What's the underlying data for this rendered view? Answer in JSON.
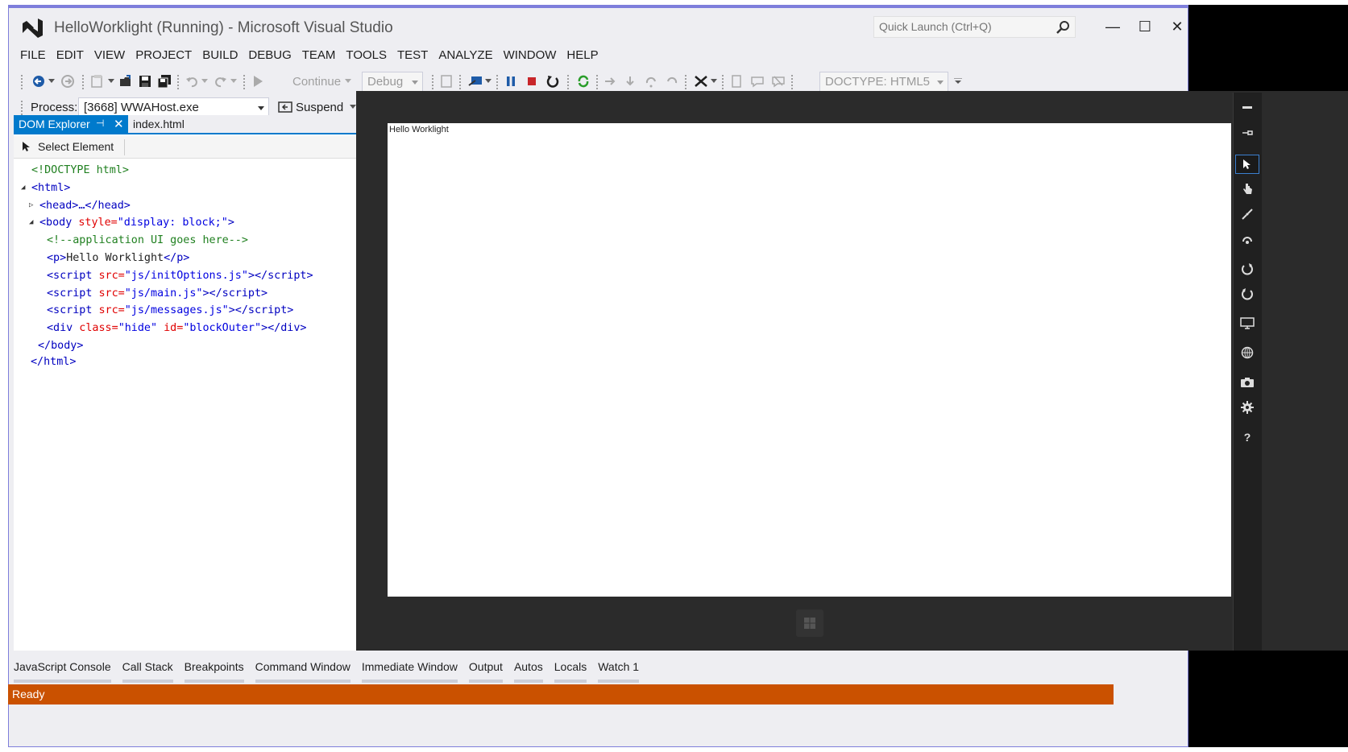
{
  "window": {
    "title": "HelloWorklight (Running) - Microsoft Visual Studio",
    "quick_launch_placeholder": "Quick Launch (Ctrl+Q)",
    "minimize": "—",
    "maximize": "☐",
    "close": "✕"
  },
  "menu": [
    "FILE",
    "EDIT",
    "VIEW",
    "PROJECT",
    "BUILD",
    "DEBUG",
    "TEAM",
    "TOOLS",
    "TEST",
    "ANALYZE",
    "WINDOW",
    "HELP"
  ],
  "toolbar": {
    "continue_label": "Continue",
    "config_value": "Debug",
    "doctype_value": "DOCTYPE: HTML5",
    "process_label": "Process:",
    "process_value": "[3668] WWAHost.exe",
    "suspend_label": "Suspend"
  },
  "dom_explorer": {
    "tab_label": "DOM Explorer",
    "tab_pin": "⊣",
    "tab_close": "✕",
    "file_tab": "index.html",
    "select_element_label": "Select Element"
  },
  "dom_tree": {
    "doctype": "<!DOCTYPE html>",
    "html_open": "<html>",
    "head": "<head>…</head>",
    "body_open_tag": "<body",
    "body_attr": " style=",
    "body_val": "\"display: block;\"",
    "body_close_bracket": ">",
    "comment": "<!--application UI goes here-->",
    "p_open": "<p>",
    "p_text": "Hello Worklight",
    "p_close": "</p>",
    "script1_src": "\"js/initOptions.js\"",
    "script2_src": "\"js/main.js\"",
    "script3_src": "\"js/messages.js\"",
    "div_class": "\"hide\"",
    "div_id": "\"blockOuter\"",
    "body_close": "</body>",
    "html_close": "</html>"
  },
  "simulator": {
    "screen_text": "Hello Worklight"
  },
  "bottom_tabs": [
    "JavaScript Console",
    "Call Stack",
    "Breakpoints",
    "Command Window",
    "Immediate Window",
    "Output",
    "Autos",
    "Locals",
    "Watch 1"
  ],
  "status": "Ready",
  "colors": {
    "accent": "#007acc",
    "status_bar": "#ca5100",
    "window_border": "#7e7edb"
  }
}
